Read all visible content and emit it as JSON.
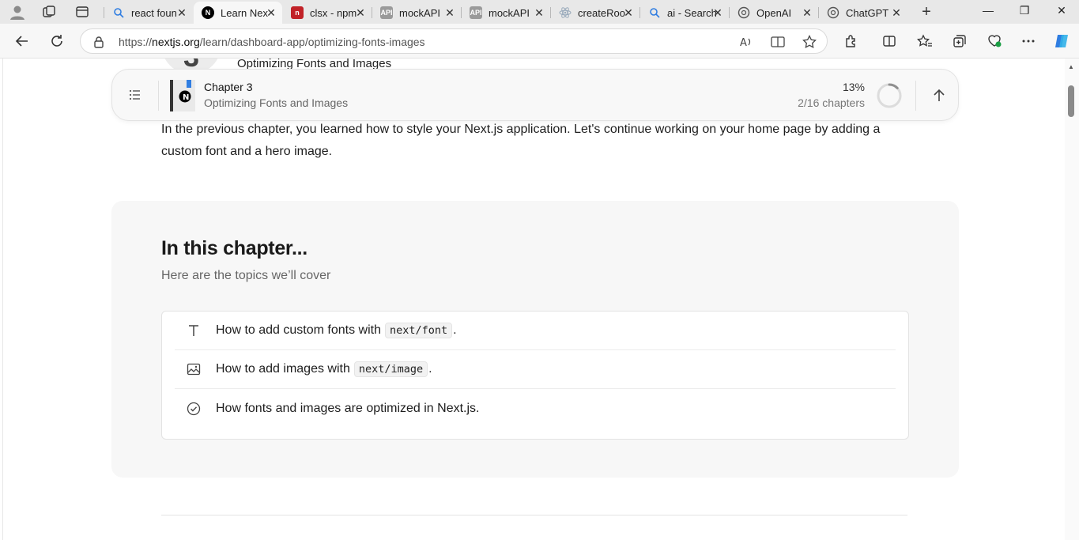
{
  "tabs": [
    {
      "title": "react foun",
      "favicon": "search-icon",
      "active": false
    },
    {
      "title": "Learn Nex",
      "favicon": "nextjs-logo",
      "active": true
    },
    {
      "title": "clsx - npm",
      "favicon": "npm-logo",
      "active": false
    },
    {
      "title": "mockAPI",
      "favicon": "api-logo",
      "active": false
    },
    {
      "title": "mockAPI",
      "favicon": "api-logo",
      "active": false
    },
    {
      "title": "createRoo",
      "favicon": "react-logo",
      "active": false
    },
    {
      "title": "ai - Search",
      "favicon": "search-icon",
      "active": false
    },
    {
      "title": "OpenAI",
      "favicon": "openai-logo",
      "active": false
    },
    {
      "title": "ChatGPT",
      "favicon": "openai-logo",
      "active": false
    }
  ],
  "address": {
    "url_prefix": "https://",
    "url_host": "nextjs.org",
    "url_path": "/learn/dashboard-app/optimizing-fonts-images"
  },
  "behind_header": {
    "number": "3",
    "title": "Optimizing Fonts and Images"
  },
  "chapter_bar": {
    "title": "Chapter 3",
    "subtitle": "Optimizing Fonts and Images",
    "percent": "13%",
    "progress": 0.13,
    "chapters": "2/16 chapters"
  },
  "intro": "In the previous chapter, you learned how to style your Next.js application. Let's continue working on your home page by adding a custom font and a hero image.",
  "topics": {
    "heading": "In this chapter...",
    "subheading": "Here are the topics we’ll cover",
    "items": [
      {
        "text": "How to add custom fonts with",
        "code": "next/font",
        "suffix": ".",
        "icon": "text-icon"
      },
      {
        "text": "How to add images with",
        "code": "next/image",
        "suffix": ".",
        "icon": "image-icon"
      },
      {
        "text": "How fonts and images are optimized in Next.js.",
        "code": "",
        "suffix": "",
        "icon": "check-circle-icon"
      }
    ]
  },
  "colors": {
    "accent_blue": "#2f7de1",
    "progress_ring": "#d9d9d9"
  }
}
